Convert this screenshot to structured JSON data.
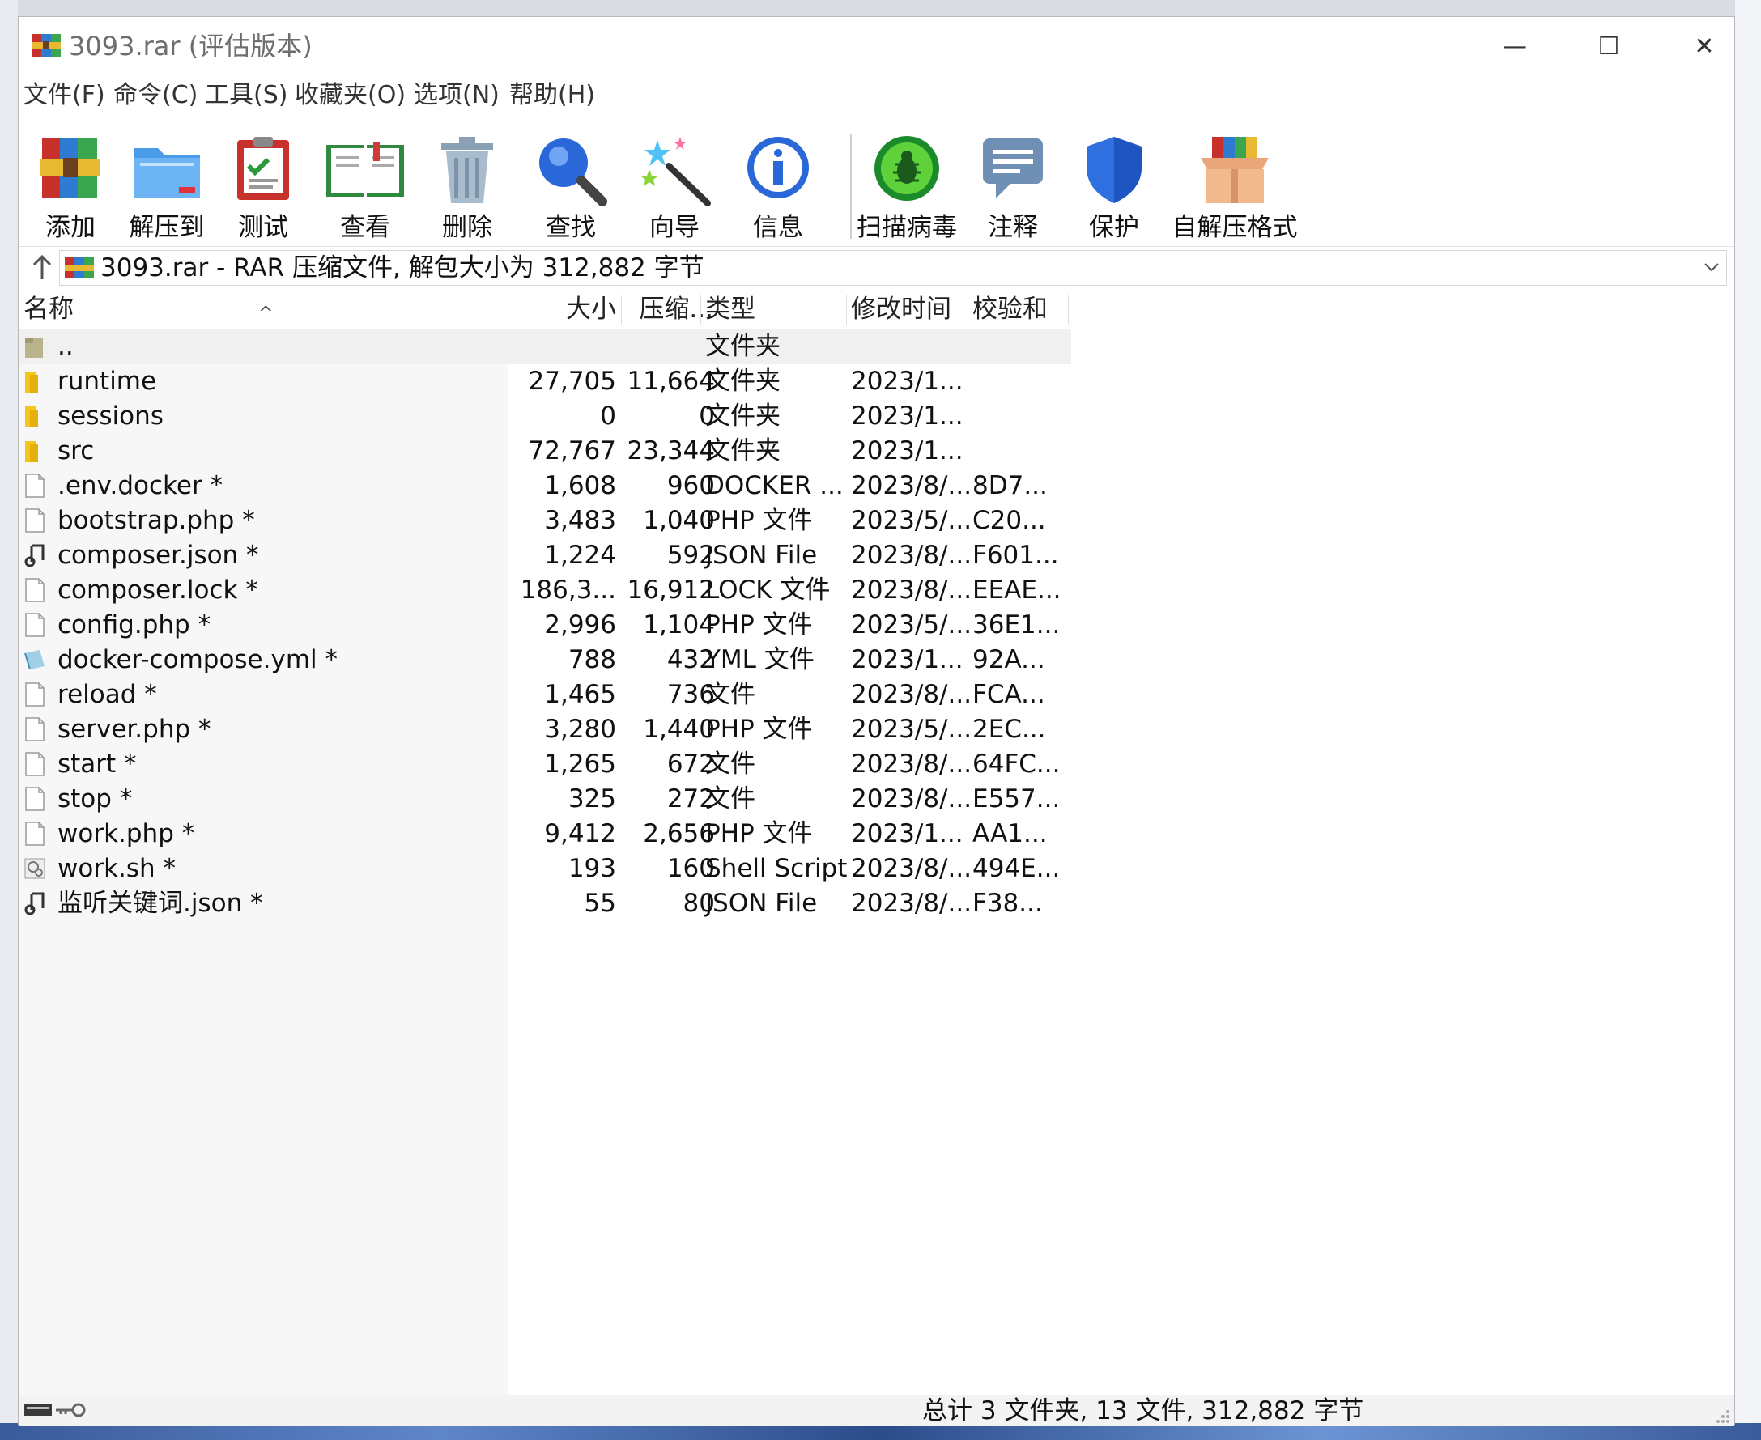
{
  "window": {
    "title": "3093.rar (评估版本)",
    "minimize_glyph": "—",
    "maximize_glyph": "☐",
    "close_glyph": "✕"
  },
  "menu": [
    "文件(F)",
    "命令(C)",
    "工具(S)",
    "收藏夹(O)",
    "选项(N)",
    "帮助(H)"
  ],
  "toolbar": [
    {
      "label": "添加",
      "icon": "add-archive-icon"
    },
    {
      "label": "解压到",
      "icon": "extract-to-icon"
    },
    {
      "label": "测试",
      "icon": "test-clipboard-icon"
    },
    {
      "label": "查看",
      "icon": "view-book-icon"
    },
    {
      "label": "删除",
      "icon": "trash-bin-icon"
    },
    {
      "label": "查找",
      "icon": "magnifier-icon"
    },
    {
      "label": "向导",
      "icon": "wizard-wand-icon"
    },
    {
      "label": "信息",
      "icon": "info-icon"
    },
    {
      "label": "扫描病毒",
      "icon": "virus-scan-icon"
    },
    {
      "label": "注释",
      "icon": "comment-icon"
    },
    {
      "label": "保护",
      "icon": "shield-icon"
    },
    {
      "label": "自解压格式",
      "icon": "sfx-box-icon"
    }
  ],
  "address": {
    "text": "3093.rar - RAR 压缩文件, 解包大小为 312,882 字节"
  },
  "columns": {
    "name": "名称",
    "size": "大小",
    "packed": "压缩...",
    "type": "类型",
    "modified": "修改时间",
    "crc": "校验和"
  },
  "rows": [
    {
      "name": "..",
      "size": "",
      "packed": "",
      "type": "文件夹",
      "modified": "",
      "crc": "",
      "icon": "parent-folder-icon"
    },
    {
      "name": "runtime",
      "size": "27,705",
      "packed": "11,664",
      "type": "文件夹",
      "modified": "2023/1...",
      "crc": "",
      "icon": "folder-icon"
    },
    {
      "name": "sessions",
      "size": "0",
      "packed": "0",
      "type": "文件夹",
      "modified": "2023/1...",
      "crc": "",
      "icon": "folder-icon"
    },
    {
      "name": "src",
      "size": "72,767",
      "packed": "23,344",
      "type": "文件夹",
      "modified": "2023/1...",
      "crc": "",
      "icon": "folder-icon"
    },
    {
      "name": ".env.docker *",
      "size": "1,608",
      "packed": "960",
      "type": "DOCKER ...",
      "modified": "2023/8/...",
      "crc": "8D7...",
      "icon": "file-icon"
    },
    {
      "name": "bootstrap.php *",
      "size": "3,483",
      "packed": "1,040",
      "type": "PHP 文件",
      "modified": "2023/5/...",
      "crc": "C20...",
      "icon": "file-icon"
    },
    {
      "name": "composer.json *",
      "size": "1,224",
      "packed": "592",
      "type": "JSON File",
      "modified": "2023/8/...",
      "crc": "F601...",
      "icon": "json-file-icon"
    },
    {
      "name": "composer.lock *",
      "size": "186,3...",
      "packed": "16,912",
      "type": "LOCK 文件",
      "modified": "2023/8/...",
      "crc": "EEAE...",
      "icon": "file-icon"
    },
    {
      "name": "config.php *",
      "size": "2,996",
      "packed": "1,104",
      "type": "PHP 文件",
      "modified": "2023/5/...",
      "crc": "36E1...",
      "icon": "file-icon"
    },
    {
      "name": "docker-compose.yml *",
      "size": "788",
      "packed": "432",
      "type": "YML 文件",
      "modified": "2023/1...",
      "crc": "92A...",
      "icon": "yml-file-icon"
    },
    {
      "name": "reload *",
      "size": "1,465",
      "packed": "736",
      "type": "文件",
      "modified": "2023/8/...",
      "crc": "FCA...",
      "icon": "file-icon"
    },
    {
      "name": "server.php *",
      "size": "3,280",
      "packed": "1,440",
      "type": "PHP 文件",
      "modified": "2023/5/...",
      "crc": "2EC...",
      "icon": "file-icon"
    },
    {
      "name": "start *",
      "size": "1,265",
      "packed": "672",
      "type": "文件",
      "modified": "2023/8/...",
      "crc": "64FC...",
      "icon": "file-icon"
    },
    {
      "name": "stop *",
      "size": "325",
      "packed": "272",
      "type": "文件",
      "modified": "2023/8/...",
      "crc": "E557...",
      "icon": "file-icon"
    },
    {
      "name": "work.php *",
      "size": "9,412",
      "packed": "2,656",
      "type": "PHP 文件",
      "modified": "2023/1...",
      "crc": "AA1...",
      "icon": "file-icon"
    },
    {
      "name": "work.sh *",
      "size": "193",
      "packed": "160",
      "type": "Shell Script",
      "modified": "2023/8/...",
      "crc": "494E...",
      "icon": "shell-script-icon"
    },
    {
      "name": "监听关键词.json *",
      "size": "55",
      "packed": "80",
      "type": "JSON File",
      "modified": "2023/8/...",
      "crc": "F38...",
      "icon": "json-file-icon"
    }
  ],
  "status": {
    "text": "总计 3 文件夹, 13 文件, 312,882 字节"
  },
  "colors": {
    "selected_row": "#f0f0f0",
    "folder_yellow": "#f5c518",
    "left_pane": "#f7f7f7"
  }
}
